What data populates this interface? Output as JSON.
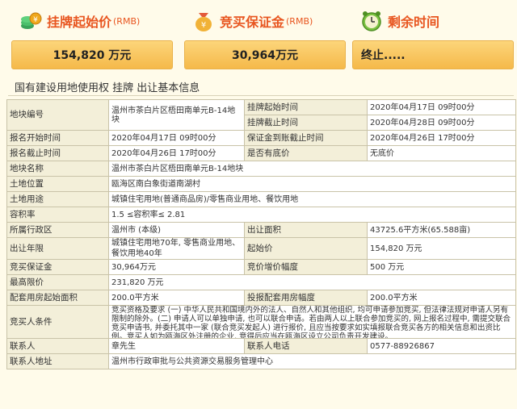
{
  "cards": [
    {
      "label": "挂牌起始价",
      "unit": "(RMB)",
      "value": "154,820 万元",
      "icon": "coin-stack-icon"
    },
    {
      "label": "竞买保证金",
      "unit": "(RMB)",
      "value": "30,964万元",
      "icon": "money-bag-icon"
    },
    {
      "label": "剩余时间",
      "unit": "",
      "value": "终止.....",
      "icon": "alarm-clock-icon"
    }
  ],
  "heading": "国有建设用地使用权 挂牌 出让基本信息",
  "rows": {
    "r1": {
      "k1": "地块编号",
      "v1": "温州市茶白片区梧田南单元B-14地块",
      "k2a": "挂牌起始时间",
      "v2a": "2020年04月17日 09时00分",
      "k2b": "挂牌截止时间",
      "v2b": "2020年04月28日 09时00分"
    },
    "r3": {
      "k1": "报名开始时间",
      "v1": "2020年04月17日 09时00分",
      "k2": "保证金到账截止时间",
      "v2": "2020年04月26日 17时00分"
    },
    "r4": {
      "k1": "报名截止时间",
      "v1": "2020年04月26日 17时00分",
      "k2": "是否有底价",
      "v2": "无底价"
    },
    "r5": {
      "k1": "地块名称",
      "v1": "温州市茶白片区梧田南单元B-14地块"
    },
    "r6": {
      "k1": "土地位置",
      "v1": "瓯海区南白象街道南湖村"
    },
    "r7": {
      "k1": "土地用途",
      "v1": "城镇住宅用地(普通商品房)/零售商业用地、餐饮用地"
    },
    "r8": {
      "k1": "容积率",
      "v1": "1.5 ≤容积率≤ 2.81"
    },
    "r9": {
      "k1": "所属行政区",
      "v1": "温州市 (本级)",
      "k2": "出让面积",
      "v2": "43725.6平方米(65.588亩)"
    },
    "r10": {
      "k1": "出让年限",
      "v1a": "城镇住宅用地70年, 零售商业用地、",
      "v1b": "餐饮用地40年",
      "k2": "起始价",
      "v2": "154,820 万元"
    },
    "r11": {
      "k1": "竞买保证金",
      "v1": "30,964万元",
      "k2": "竞价增价幅度",
      "v2": "500 万元"
    },
    "r12": {
      "k1": "最高限价",
      "v1": "231,820 万元"
    },
    "r13": {
      "k1": "配套用房起始面积",
      "v1": "200.0平方米",
      "k2": "投报配套用房幅度",
      "v2": "200.0平方米"
    },
    "r14": {
      "k1": "竞买人条件",
      "v1": "竞买资格及要求 (一) 中华人民共和国境内外的法人、自然人和其他组织, 均可申请参加竞买, 但法律法规对申请人另有限制的除外。(二) 申请人可以单独申请, 也可以联合申请。若由两人以上联合参加竞买的, 网上报名过程中, 需提交联合竞买申请书, 并委托其中一家 (联合竞买发起人) 进行报价, 且应当按要求如实填报联合竞买各方的相关信息和出资比例。竞买人如为瓯海区外注册的企业, 竞得后应当在瓯海区设立公司负责开发建设。"
    },
    "r15": {
      "k1": "联系人",
      "v1": "章先生",
      "k2": "联系人电话",
      "v2": "0577-88926867"
    },
    "r16": {
      "k1": "联系人地址",
      "v1": "温州市行政审批与公共资源交易服务管理中心"
    }
  }
}
